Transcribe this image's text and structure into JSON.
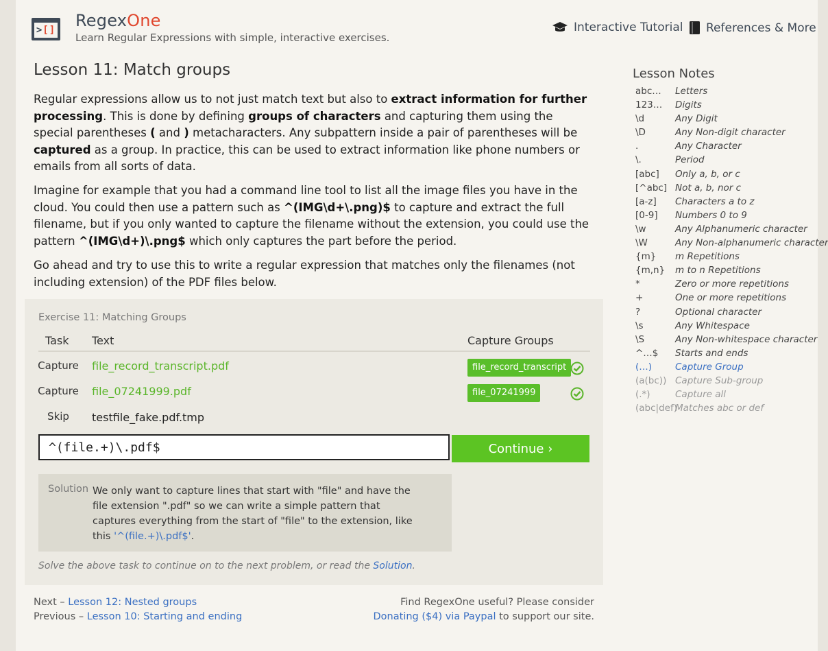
{
  "header": {
    "brand_main": "Regex",
    "brand_accent": "One",
    "tagline": "Learn Regular Expressions with simple, interactive exercises.",
    "nav": [
      {
        "label": "Interactive Tutorial",
        "icon": "graduation-cap-icon"
      },
      {
        "label": "References & More",
        "icon": "book-icon"
      }
    ],
    "logo_icon": "terminal-brackets-icon"
  },
  "lesson": {
    "title": "Lesson 11: Match groups",
    "p1": [
      {
        "t": "Regular expressions allow us to not just match text but also to ",
        "b": false
      },
      {
        "t": "extract information for further processing",
        "b": true
      },
      {
        "t": ". This is done by defining ",
        "b": false
      },
      {
        "t": "groups of characters",
        "b": true
      },
      {
        "t": " and capturing them using the special parentheses ",
        "b": false
      },
      {
        "t": "(",
        "b": true
      },
      {
        "t": " and ",
        "b": false
      },
      {
        "t": ")",
        "b": true
      },
      {
        "t": " metacharacters. Any subpattern inside a pair of parentheses will be ",
        "b": false
      },
      {
        "t": "captured",
        "b": true
      },
      {
        "t": " as a group. In practice, this can be used to extract information like phone numbers or emails from all sorts of data.",
        "b": false
      }
    ],
    "p2": [
      {
        "t": "Imagine for example that you had a command line tool to list all the image files you have in the cloud. You could then use a pattern such as ",
        "b": false
      },
      {
        "t": "^(IMG\\d+\\.png)$",
        "b": true
      },
      {
        "t": " to capture and extract the full filename, but if you only wanted to capture the filename without the extension, you could use the pattern ",
        "b": false
      },
      {
        "t": "^(IMG\\d+)\\.png$",
        "b": true
      },
      {
        "t": " which only captures the part before the period.",
        "b": false
      }
    ],
    "p3": "Go ahead and try to use this to write a regular expression that matches only the filenames (not including extension) of the PDF files below."
  },
  "exercise": {
    "title": "Exercise 11: Matching Groups",
    "headers": {
      "task": "Task",
      "text": "Text",
      "groups": "Capture Groups"
    },
    "rows": [
      {
        "task": "Capture",
        "text": "file_record_transcript.pdf",
        "group": "file_record_transcript",
        "matched": true
      },
      {
        "task": "Capture",
        "text": "file_07241999.pdf",
        "group": "file_07241999",
        "matched": true
      },
      {
        "task": "Skip",
        "text": "testfile_fake.pdf.tmp",
        "group": "",
        "matched": false
      }
    ],
    "input_value": "^(file.+)\\.pdf$",
    "continue_label": "Continue ›",
    "solution_label": "Solution",
    "solution_text": "We only want to capture lines that start with \"file\" and have the file extension \".pdf\" so we can write a simple pattern that captures everything from the start of \"file\" to the extension, like this",
    "solution_code": "'^(file.+)\\.pdf$'",
    "solution_end": ".",
    "hint_prefix": "Solve the above task to continue on to the next problem, or read the ",
    "hint_link": "Solution",
    "hint_suffix": ".",
    "colors": {
      "match": "#5ab52a",
      "badge": "#5abe2a",
      "button": "#5cc423"
    }
  },
  "footer": {
    "next_prefix": "Next – ",
    "next_link": "Lesson 12: Nested groups",
    "prev_prefix": "Previous – ",
    "prev_link": "Lesson 10: Starting and ending",
    "right_line1": "Find RegexOne useful? Please consider",
    "donate_link": "Donating ($4) via Paypal",
    "right_suffix": " to support our site."
  },
  "notes": {
    "title": "Lesson Notes",
    "items": [
      {
        "k": "abc…",
        "v": "Letters",
        "state": "done"
      },
      {
        "k": "123…",
        "v": "Digits",
        "state": "done"
      },
      {
        "k": "\\d",
        "v": "Any Digit",
        "state": "done"
      },
      {
        "k": "\\D",
        "v": "Any Non-digit character",
        "state": "done"
      },
      {
        "k": ".",
        "v": "Any Character",
        "state": "done"
      },
      {
        "k": "\\.",
        "v": "Period",
        "state": "done"
      },
      {
        "k": "[abc]",
        "v": "Only a, b, or c",
        "state": "done"
      },
      {
        "k": "[^abc]",
        "v": "Not a, b, nor c",
        "state": "done"
      },
      {
        "k": "[a-z]",
        "v": "Characters a to z",
        "state": "done"
      },
      {
        "k": "[0-9]",
        "v": "Numbers 0 to 9",
        "state": "done"
      },
      {
        "k": "\\w",
        "v": "Any Alphanumeric character",
        "state": "done"
      },
      {
        "k": "\\W",
        "v": "Any Non-alphanumeric character",
        "state": "done"
      },
      {
        "k": "{m}",
        "v": "m Repetitions",
        "state": "done"
      },
      {
        "k": "{m,n}",
        "v": "m to n Repetitions",
        "state": "done"
      },
      {
        "k": "*",
        "v": "Zero or more repetitions",
        "state": "done"
      },
      {
        "k": "+",
        "v": "One or more repetitions",
        "state": "done"
      },
      {
        "k": "?",
        "v": "Optional character",
        "state": "done"
      },
      {
        "k": "\\s",
        "v": "Any Whitespace",
        "state": "done"
      },
      {
        "k": "\\S",
        "v": "Any Non-whitespace character",
        "state": "done"
      },
      {
        "k": "^…$",
        "v": "Starts and ends",
        "state": "done"
      },
      {
        "k": "(…)",
        "v": "Capture Group",
        "state": "active"
      },
      {
        "k": "(a(bc))",
        "v": "Capture Sub-group",
        "state": "future"
      },
      {
        "k": "(.*)",
        "v": "Capture all",
        "state": "future"
      },
      {
        "k": "(abc|def)",
        "v": "Matches abc or def",
        "state": "future"
      }
    ]
  }
}
